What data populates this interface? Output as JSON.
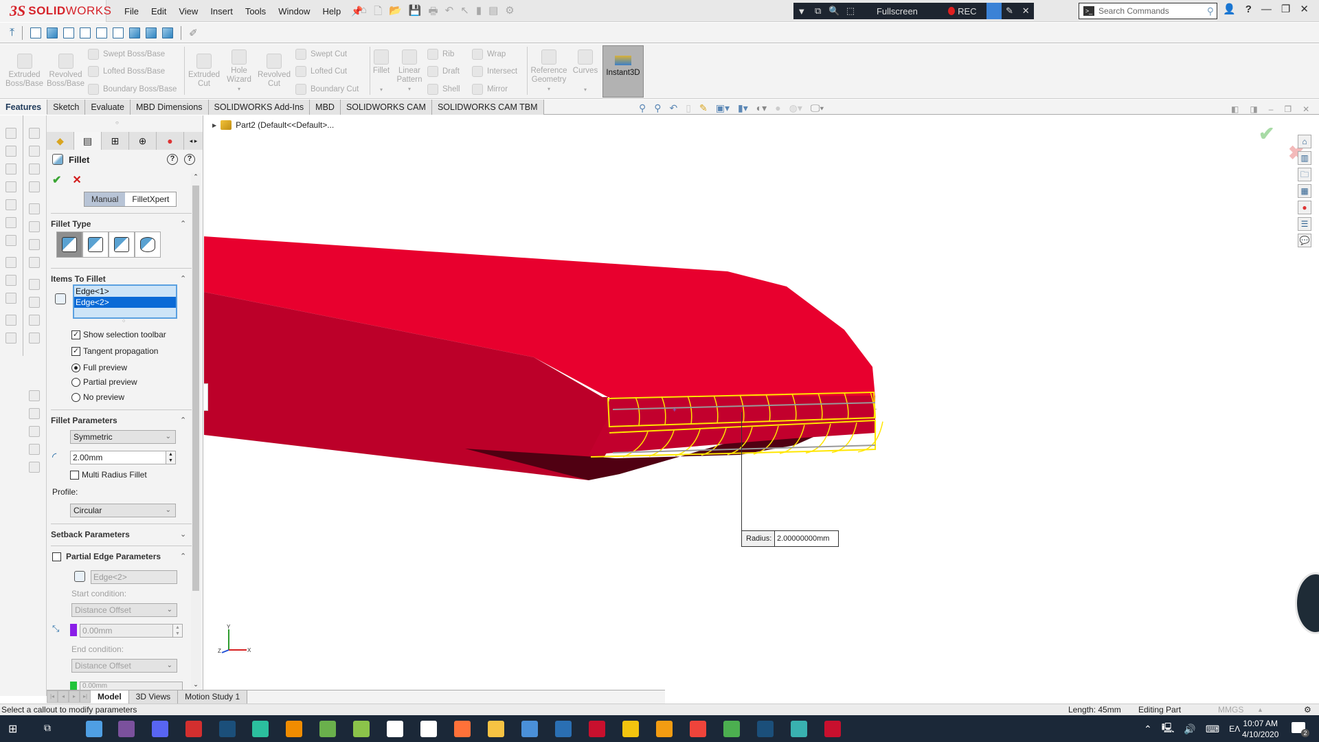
{
  "app": {
    "brand_ds": "3S",
    "brand_solid": "SOLID",
    "brand_works": "WORKS"
  },
  "menu": [
    "File",
    "Edit",
    "View",
    "Insert",
    "Tools",
    "Window",
    "Help"
  ],
  "recorder": {
    "fullscreen_label": "Fullscreen",
    "rec_label": "REC"
  },
  "search": {
    "placeholder": "Search Commands"
  },
  "command_manager": {
    "buttons": {
      "extruded_boss": "Extruded Boss/Base",
      "revolved_boss": "Revolved Boss/Base",
      "swept_boss": "Swept Boss/Base",
      "lofted_boss": "Lofted Boss/Base",
      "boundary_boss": "Boundary Boss/Base",
      "extruded_cut": "Extruded Cut",
      "hole_wizard": "Hole Wizard",
      "revolved_cut": "Revolved Cut",
      "swept_cut": "Swept Cut",
      "lofted_cut": "Lofted Cut",
      "boundary_cut": "Boundary Cut",
      "fillet": "Fillet",
      "linear_pattern": "Linear Pattern",
      "rib": "Rib",
      "draft": "Draft",
      "shell": "Shell",
      "wrap": "Wrap",
      "intersect": "Intersect",
      "mirror": "Mirror",
      "reference_geometry": "Reference Geometry",
      "curves": "Curves",
      "instant3d": "Instant3D"
    },
    "tabs": [
      "Features",
      "Sketch",
      "Evaluate",
      "MBD Dimensions",
      "SOLIDWORKS Add-Ins",
      "MBD",
      "SOLIDWORKS CAM",
      "SOLIDWORKS CAM TBM"
    ],
    "active_tab": "Features"
  },
  "feature_tree": {
    "part_label": "Part2  (Default<<Default>..."
  },
  "property_manager": {
    "title": "Fillet",
    "modes": [
      "Manual",
      "FilletXpert"
    ],
    "active_mode": "Manual",
    "fillet_type": {
      "heading": "Fillet Type",
      "options": [
        "constant-size",
        "variable-size",
        "face",
        "full-round"
      ],
      "selected_index": 0
    },
    "items_to_fillet": {
      "heading": "Items To Fillet",
      "items": [
        "Edge<1>",
        "Edge<2>"
      ],
      "selected_item": "Edge<2>",
      "show_selection_toolbar": {
        "label": "Show selection toolbar",
        "checked": true
      },
      "tangent_propagation": {
        "label": "Tangent propagation",
        "checked": true
      },
      "preview": {
        "options": [
          "Full preview",
          "Partial preview",
          "No preview"
        ],
        "selected": "Full preview"
      }
    },
    "fillet_parameters": {
      "heading": "Fillet Parameters",
      "method": "Symmetric",
      "radius": "2.00mm",
      "multi_radius": {
        "label": "Multi Radius Fillet",
        "checked": false
      },
      "profile_label": "Profile:",
      "profile": "Circular"
    },
    "setback_parameters": {
      "heading": "Setback Parameters"
    },
    "partial_edge_parameters": {
      "heading": "Partial Edge Parameters",
      "checked": false,
      "edge": "Edge<2>",
      "start_condition_label": "Start condition:",
      "start_condition": "Distance Offset",
      "start_value": "0.00mm",
      "start_color": "#8a1ee8",
      "end_condition_label": "End condition:",
      "end_condition": "Distance Offset",
      "end_value": "0.00mm",
      "end_color": "#22c43a"
    }
  },
  "graphics": {
    "callout_key": "Radius:",
    "callout_value": "2.00000000mm",
    "part_color": "#e8002e",
    "highlight_color": "#ffe600"
  },
  "bottom_tabs": [
    "Model",
    "3D Views",
    "Motion Study 1"
  ],
  "active_bottom_tab": "Model",
  "status": {
    "message": "Select a callout to modify parameters",
    "length": "Length: 45mm",
    "mode": "Editing Part",
    "units": "MMGS"
  },
  "taskbar": {
    "language": "ΕΛ",
    "time": "10:07 AM",
    "date": "4/10/2020",
    "notifications": "2"
  }
}
